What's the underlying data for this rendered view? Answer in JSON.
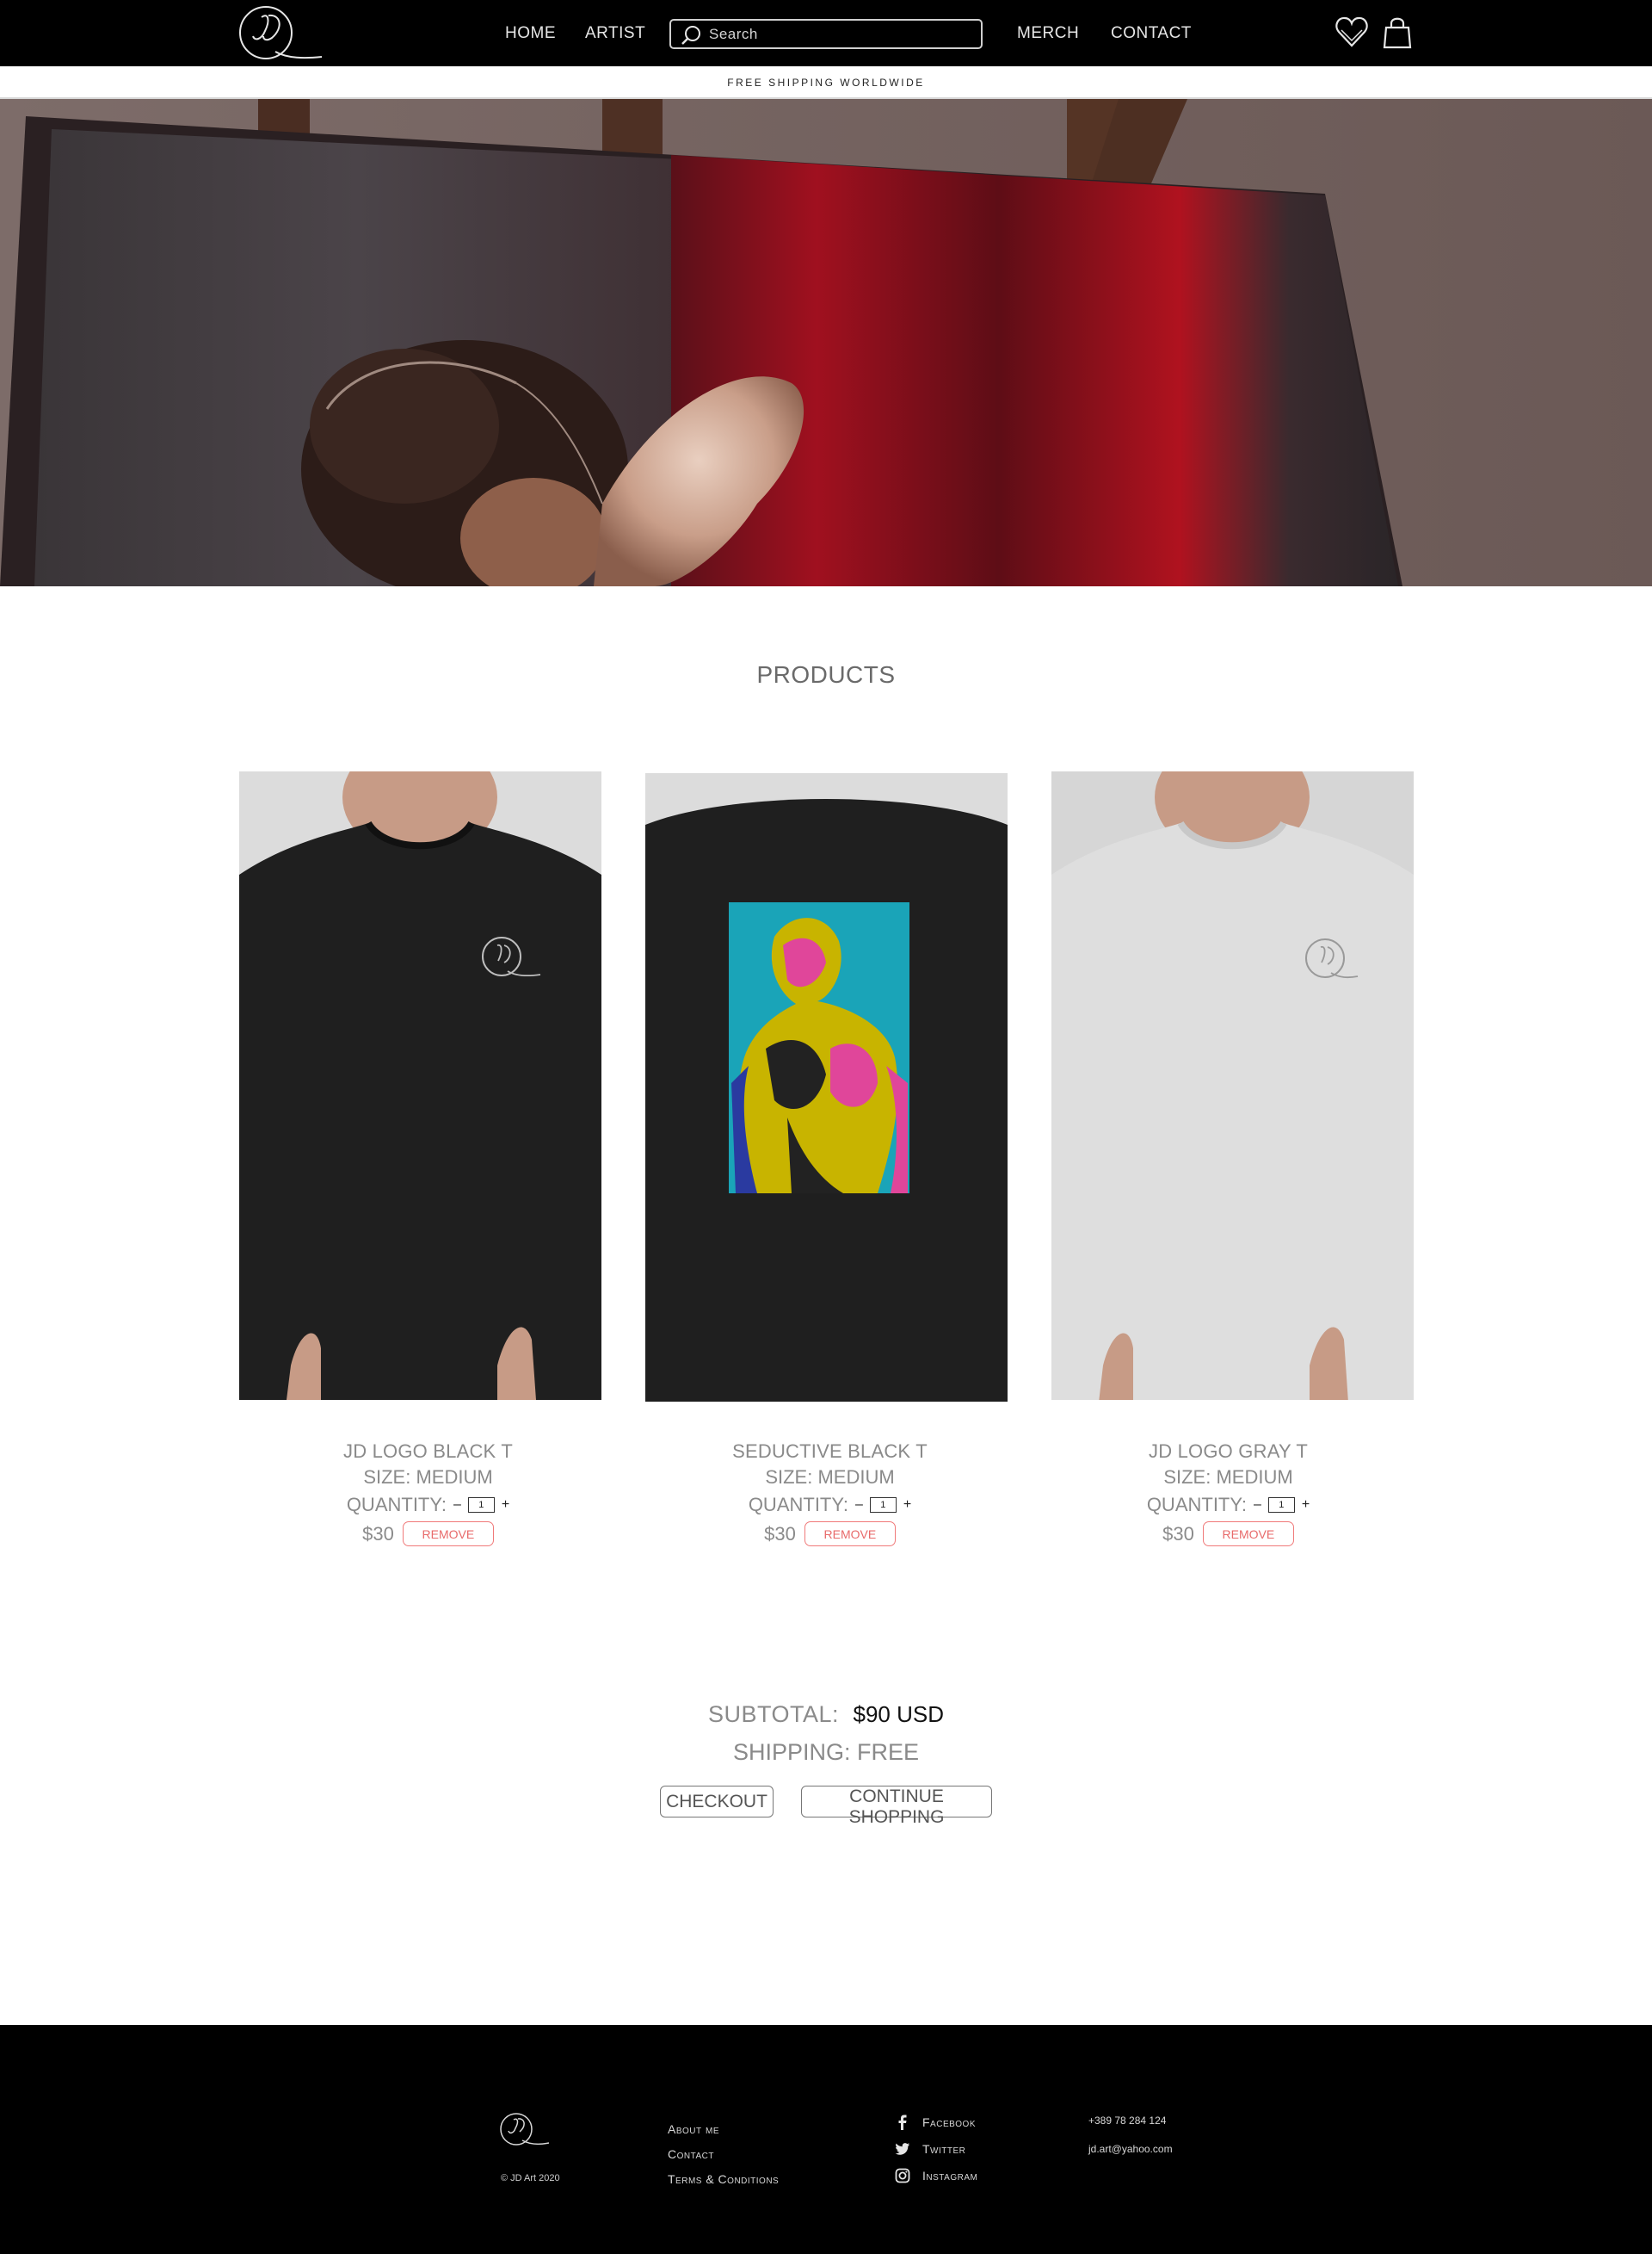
{
  "header": {
    "nav": {
      "home": "HOME",
      "artist": "ARTIST",
      "merch": "MERCH",
      "contact": "CONTACT"
    },
    "search_placeholder": "Search"
  },
  "banner": {
    "text": "FREE SHIPPING WORLDWIDE"
  },
  "products": {
    "title": "PRODUCTS",
    "items": [
      {
        "name": "JD LOGO BLACK T",
        "size": "SIZE: MEDIUM",
        "quantity_label": "QUANTITY:",
        "quantity": "1",
        "price": "$30",
        "remove_label": "REMOVE",
        "shirt_color": "#1f1f1f"
      },
      {
        "name": "SEDUCTIVE BLACK T",
        "size": "SIZE: MEDIUM",
        "quantity_label": "QUANTITY:",
        "quantity": "1",
        "price": "$30",
        "remove_label": "REMOVE",
        "shirt_color": "#1f1f1f"
      },
      {
        "name": "JD LOGO GRAY T",
        "size": "SIZE: MEDIUM",
        "quantity_label": "QUANTITY:",
        "quantity": "1",
        "price": "$30",
        "remove_label": "REMOVE",
        "shirt_color": "#d9d9d9"
      }
    ],
    "quantity_minus": "–",
    "quantity_plus": "+"
  },
  "summary": {
    "subtotal_label": "SUBTOTAL:",
    "subtotal_value": "$90 USD",
    "shipping": "SHIPPING: FREE",
    "checkout_label": "CHECKOUT",
    "continue_label": "CONTINUE SHOPPING"
  },
  "footer": {
    "copyright": "© JD Art 2020",
    "links": {
      "about": "About me",
      "contact": "Contact",
      "terms": "Terms & Conditions"
    },
    "social": {
      "facebook": "Facebook",
      "twitter": "Twitter",
      "instagram": "Instagram"
    },
    "phone": "+389 78 284 124",
    "email": "jd.art@yahoo.com"
  },
  "colors": {
    "header_bg": "#000000",
    "footer_bg": "#000000",
    "remove_accent": "#e86a6a"
  }
}
